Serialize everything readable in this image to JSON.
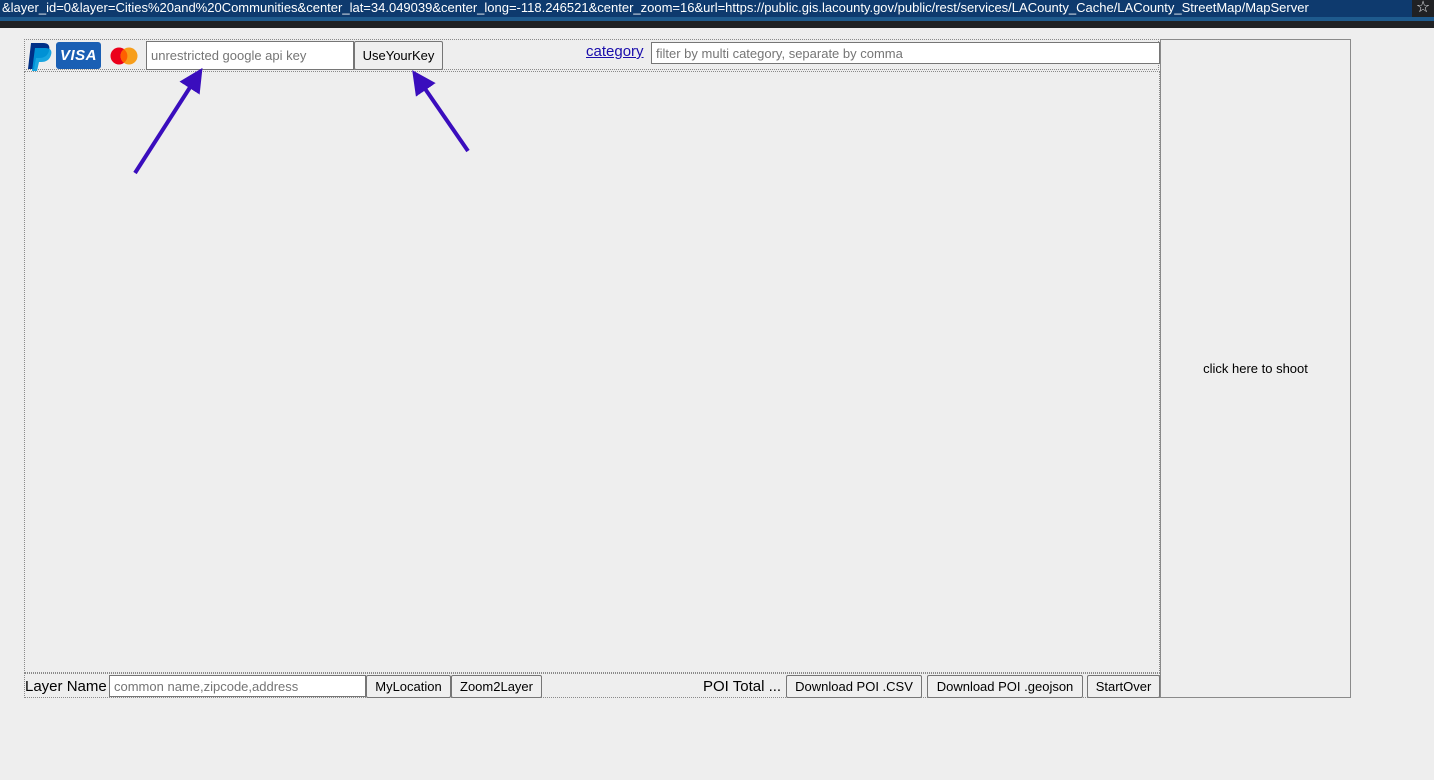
{
  "browser": {
    "url": "&layer_id=0&layer=Cities%20and%20Communities&center_lat=34.049039&center_long=-118.246521&center_zoom=16&url=https://public.gis.lacounty.gov/public/rest/services/LACounty_Cache/LACounty_StreetMap/MapServer",
    "bookmark_icon": "star-icon"
  },
  "payment": {
    "paypal_icon": "paypal-icon",
    "visa_label": "VISA",
    "mastercard_icon": "mastercard-icon"
  },
  "api_key": {
    "placeholder": "unrestricted google api key",
    "value": "",
    "button_label": "UseYourKey"
  },
  "category": {
    "link_label": "category",
    "placeholder": "filter by multi category, separate by comma"
  },
  "side_panel": {
    "shoot_label": "click here to shoot"
  },
  "bottom": {
    "layer_label": "Layer Name",
    "layer_placeholder": "common name,zipcode,address",
    "my_location_label": "MyLocation",
    "zoom_to_layer_label": "Zoom2Layer",
    "poi_total_label": "POI Total ...",
    "download_csv_label": "Download POI .CSV",
    "download_geojson_label": "Download POI .geojson",
    "start_over_label": "StartOver"
  },
  "colors": {
    "arrow": "#3a0dbd",
    "visa_blue": "#1a5fb4",
    "link": "#1a0dab",
    "page_bg": "#eeeeee"
  }
}
